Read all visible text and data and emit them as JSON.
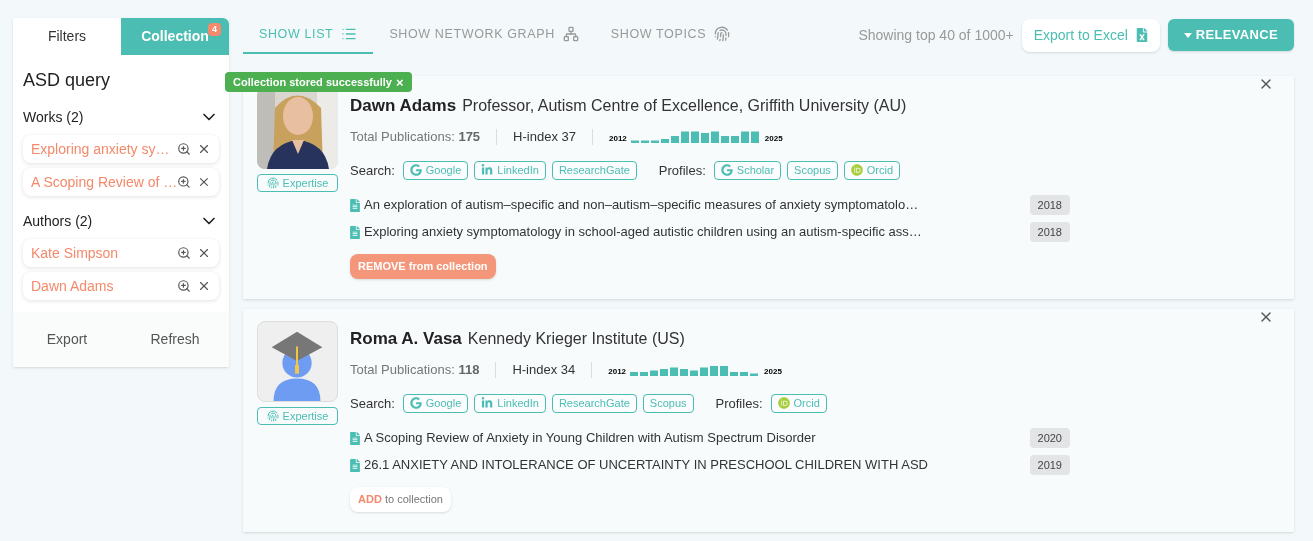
{
  "sidebar": {
    "tabs": [
      {
        "label": "Filters",
        "selected": false
      },
      {
        "label": "Collection",
        "selected": true,
        "badge": "4"
      }
    ],
    "query_title": "ASD query",
    "sections": [
      {
        "title": "Works (2)",
        "expanded": true,
        "items": [
          "Exploring anxiety sy…",
          "A Scoping Review of …"
        ]
      },
      {
        "title": "Authors (2)",
        "expanded": true,
        "items": [
          "Kate Simpson",
          "Dawn Adams"
        ]
      }
    ],
    "footer_buttons": [
      "Export",
      "Refresh"
    ]
  },
  "toast": {
    "text": "Collection stored successfully",
    "close": "×"
  },
  "view_tabs": [
    {
      "label": "SHOW LIST",
      "kind": "list",
      "selected": true
    },
    {
      "label": "SHOW NETWORK GRAPH",
      "kind": "graph",
      "selected": false
    },
    {
      "label": "SHOW TOPICS",
      "kind": "topics",
      "selected": false
    }
  ],
  "result_count": "Showing top 40 of 1000+",
  "export_button": "Export to Excel",
  "sort_button": "RELEVANCE",
  "authors": [
    {
      "name": "Dawn Adams",
      "affiliation": "Professor, Autism Centre of Excellence, Griffith University (AU)",
      "avatar": {
        "kind": "picture"
      },
      "expertise": "Expertise",
      "publications_label": "Total Publications:",
      "publications": "175",
      "hindex": "H-index 37",
      "spark_start": "2012",
      "spark_end": "2025",
      "search_label": "Search:",
      "search_links": [
        {
          "label": "Google",
          "kind": "google"
        },
        {
          "label": "LinkedIn",
          "kind": "linkedin"
        },
        {
          "label": "ResearchGate",
          "kind": "plain"
        }
      ],
      "profiles_label": "Profiles:",
      "profile_links": [
        {
          "label": "Scholar",
          "kind": "google"
        },
        {
          "label": "Scopus",
          "kind": "plain"
        },
        {
          "label": "Orcid",
          "kind": "orcid"
        }
      ],
      "works": [
        {
          "title": "An exploration of autism–specific and non–autism–specific measures of anxiety symptomatolo…",
          "year": "2018"
        },
        {
          "title": "Exploring anxiety symptomatology in school-aged autistic children using an autism-specific ass…",
          "year": "2018"
        }
      ],
      "action": {
        "kind": "remove",
        "text": "REMOVE from collection"
      }
    },
    {
      "name": "Roma A. Vasa",
      "affiliation": "Kennedy Krieger Institute (US)",
      "avatar": {
        "kind": "graduate"
      },
      "expertise": "Expertise",
      "publications_label": "Total Publications:",
      "publications": "118",
      "hindex": "H-index 34",
      "spark_start": "2012",
      "spark_end": "2025",
      "search_label": "Search:",
      "search_links": [
        {
          "label": "Google",
          "kind": "google"
        },
        {
          "label": "LinkedIn",
          "kind": "linkedin"
        },
        {
          "label": "ResearchGate",
          "kind": "plain"
        },
        {
          "label": "Scopus",
          "kind": "plain"
        }
      ],
      "profiles_label": "Profiles:",
      "profile_links": [
        {
          "label": "Orcid",
          "kind": "orcid"
        }
      ],
      "works": [
        {
          "title": "A Scoping Review of Anxiety in Young Children with Autism Spectrum Disorder",
          "year": "2020"
        },
        {
          "title": "26.1 ANXIETY AND INTOLERANCE OF UNCERTAINTY IN PRESCHOOL CHILDREN WITH ASD",
          "year": "2019"
        }
      ],
      "action": {
        "kind": "add",
        "text": "**ADD** to collection"
      }
    }
  ]
}
